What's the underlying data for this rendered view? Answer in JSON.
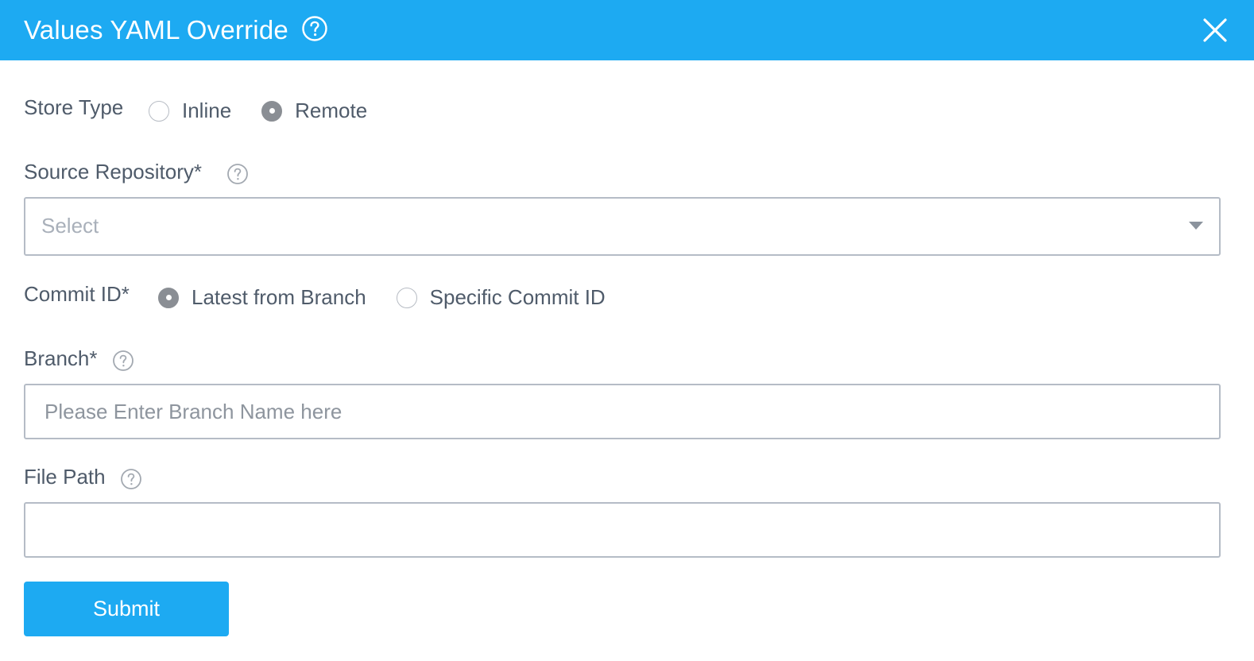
{
  "dialog": {
    "title": "Values YAML Override"
  },
  "store_type": {
    "label": "Store Type",
    "options": [
      {
        "label": "Inline",
        "checked": false
      },
      {
        "label": "Remote",
        "checked": true
      }
    ]
  },
  "source_repository": {
    "label": "Source Repository*",
    "placeholder": "Select"
  },
  "commit_id": {
    "label": "Commit ID*",
    "options": [
      {
        "label": "Latest from Branch",
        "checked": true
      },
      {
        "label": "Specific Commit ID",
        "checked": false
      }
    ]
  },
  "branch": {
    "label": "Branch*",
    "placeholder": "Please Enter Branch Name here",
    "value": ""
  },
  "file_path": {
    "label": "File Path",
    "value": ""
  },
  "actions": {
    "submit_label": "Submit"
  },
  "colors": {
    "header": "#1daaf2",
    "primary_button": "#1daaf2",
    "radio_checked": "#8a8e94",
    "border": "#b5bcc6"
  },
  "icons": {
    "help": "help-circle-icon",
    "close": "close-icon",
    "dropdown": "caret-down-icon"
  }
}
